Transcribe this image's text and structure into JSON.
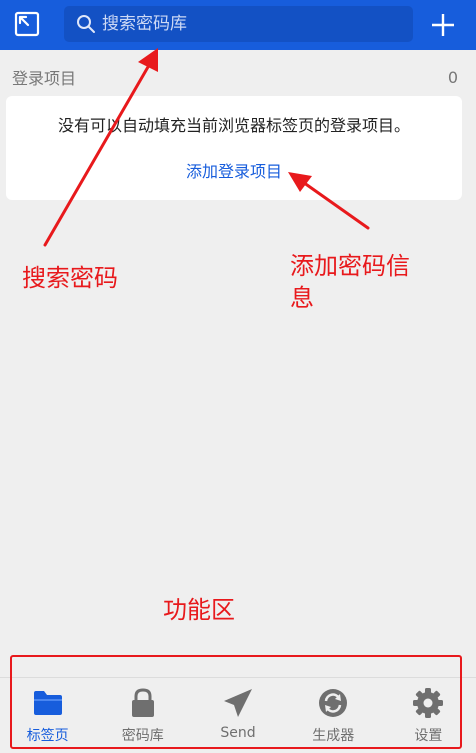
{
  "header": {
    "search_placeholder": "搜索密码库"
  },
  "section": {
    "title": "登录项目",
    "count": "0"
  },
  "empty_card": {
    "message": "没有可以自动填充当前浏览器标签页的登录项目。",
    "add_link": "添加登录项目"
  },
  "annotations": {
    "search": "搜索密码",
    "add_line1": "添加密码信",
    "add_line2": "息",
    "features": "功能区"
  },
  "nav": {
    "items": [
      {
        "label": "标签页",
        "icon": "folder-icon",
        "active": true
      },
      {
        "label": "密码库",
        "icon": "lock-icon",
        "active": false
      },
      {
        "label": "Send",
        "icon": "send-icon",
        "active": false
      },
      {
        "label": "生成器",
        "icon": "generator-icon",
        "active": false
      },
      {
        "label": "设置",
        "icon": "gear-icon",
        "active": false
      }
    ]
  },
  "colors": {
    "brand": "#175ddc",
    "annotation": "#e8191c"
  }
}
